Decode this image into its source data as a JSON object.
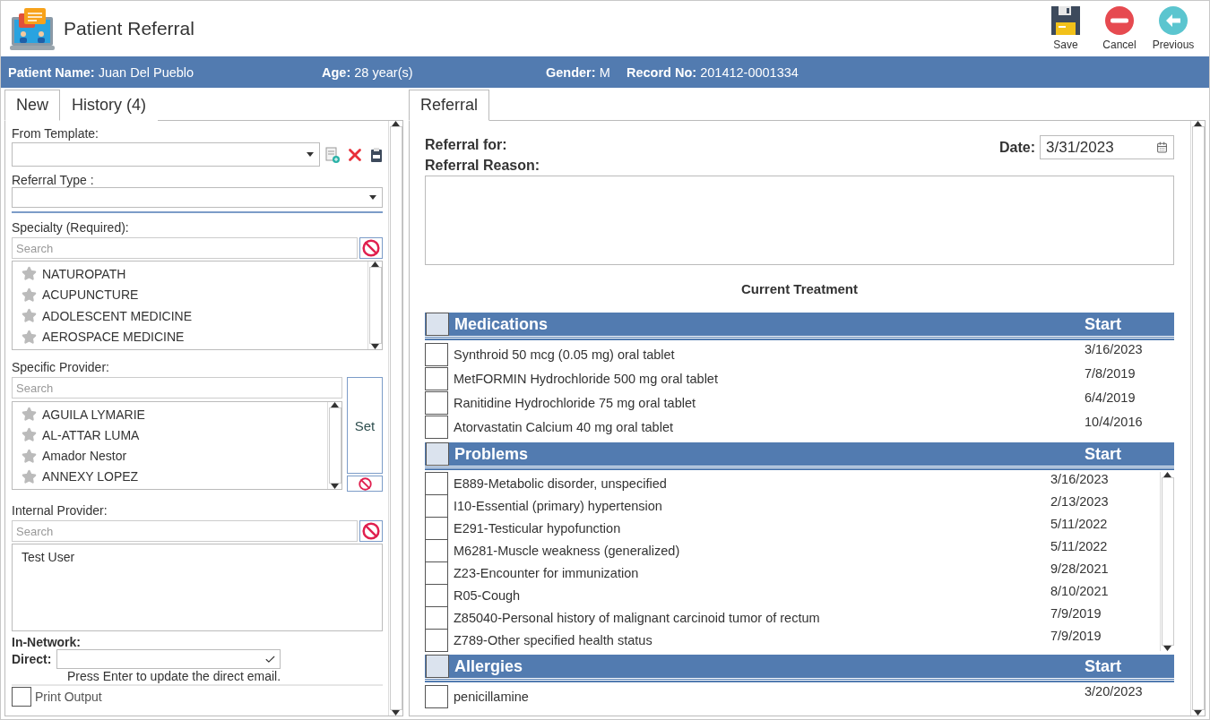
{
  "window": {
    "title": "Patient Referral"
  },
  "toolbar": [
    {
      "kind": "save",
      "label": "Save"
    },
    {
      "kind": "cancel",
      "label": "Cancel"
    },
    {
      "kind": "previous",
      "label": "Previous"
    }
  ],
  "patient_bar": [
    {
      "label": "Patient Name:",
      "value": "Juan Del Pueblo"
    },
    {
      "label": "Age:",
      "value": "28 year(s)"
    },
    {
      "label": "Gender:",
      "value": "M"
    },
    {
      "label": "Record No:",
      "value": "201412-0001334"
    }
  ],
  "left_tabs": [
    {
      "label": "New",
      "selected": true
    },
    {
      "label": "History",
      "count": "(4)",
      "selected": false
    }
  ],
  "from_template": {
    "label": "From Template:"
  },
  "referral_type": {
    "label": "Referral Type :"
  },
  "specialty": {
    "label": "Specialty (Required):",
    "placeholder": "Search",
    "items": [
      "NATUROPATH",
      "ACUPUNCTURE",
      "ADOLESCENT MEDICINE",
      "AEROSPACE MEDICINE"
    ]
  },
  "specific_provider": {
    "label": "Specific Provider:",
    "placeholder": "Search",
    "items": [
      "AGUILA LYMARIE",
      "AL-ATTAR LUMA",
      "Amador Nestor",
      "ANNEXY LOPEZ"
    ],
    "set_button": "Set"
  },
  "internal_provider": {
    "label": "Internal Provider:",
    "placeholder": "Search",
    "items": [
      "Test User"
    ]
  },
  "in_network": {
    "label": "In-Network:"
  },
  "direct": {
    "label": "Direct:",
    "hint": "Press Enter to update the direct email."
  },
  "print_output": {
    "label": "Print Output",
    "checked": false
  },
  "right_tabs": [
    {
      "label": "Referral",
      "selected": true
    }
  ],
  "referral_for": {
    "label": "Referral for:"
  },
  "date": {
    "label": "Date:",
    "value": "3/31/2023"
  },
  "referral_reason": {
    "label": "Referral Reason:"
  },
  "current_treatment": {
    "title": "Current Treatment",
    "sections": [
      {
        "kind": "list",
        "title": "Medications",
        "column": "Start",
        "checked": false,
        "rows": [
          {
            "name": "Synthroid 50 mcg (0.05 mg) oral tablet",
            "start": "3/16/2023",
            "checked": false
          },
          {
            "name": "MetFORMIN Hydrochloride 500 mg oral tablet",
            "start": "7/8/2019",
            "checked": false
          },
          {
            "name": "Ranitidine Hydrochloride 75 mg oral tablet",
            "start": "6/4/2019",
            "checked": false
          },
          {
            "name": "Atorvastatin Calcium 40 mg oral tablet",
            "start": "10/4/2016",
            "checked": false
          }
        ]
      },
      {
        "kind": "scroll-list",
        "title": "Problems",
        "column": "Start",
        "checked": false,
        "rows": [
          {
            "name": "E889-Metabolic disorder, unspecified",
            "start": "3/16/2023",
            "checked": false
          },
          {
            "name": "I10-Essential (primary) hypertension",
            "start": "2/13/2023",
            "checked": false
          },
          {
            "name": "E291-Testicular hypofunction",
            "start": "5/11/2022",
            "checked": false
          },
          {
            "name": "M6281-Muscle weakness (generalized)",
            "start": "5/11/2022",
            "checked": false
          },
          {
            "name": "Z23-Encounter for immunization",
            "start": "9/28/2021",
            "checked": false
          },
          {
            "name": "R05-Cough",
            "start": "8/10/2021",
            "checked": false
          },
          {
            "name": "Z85040-Personal history of malignant carcinoid tumor of rectum",
            "start": "7/9/2019",
            "checked": false
          },
          {
            "name": "Z789-Other specified health status",
            "start": "7/9/2019",
            "checked": false
          }
        ]
      },
      {
        "kind": "list",
        "title": "Allergies",
        "column": "Start",
        "checked": false,
        "rows": [
          {
            "name": "penicillamine",
            "start": "3/20/2023",
            "checked": false
          }
        ]
      }
    ]
  }
}
